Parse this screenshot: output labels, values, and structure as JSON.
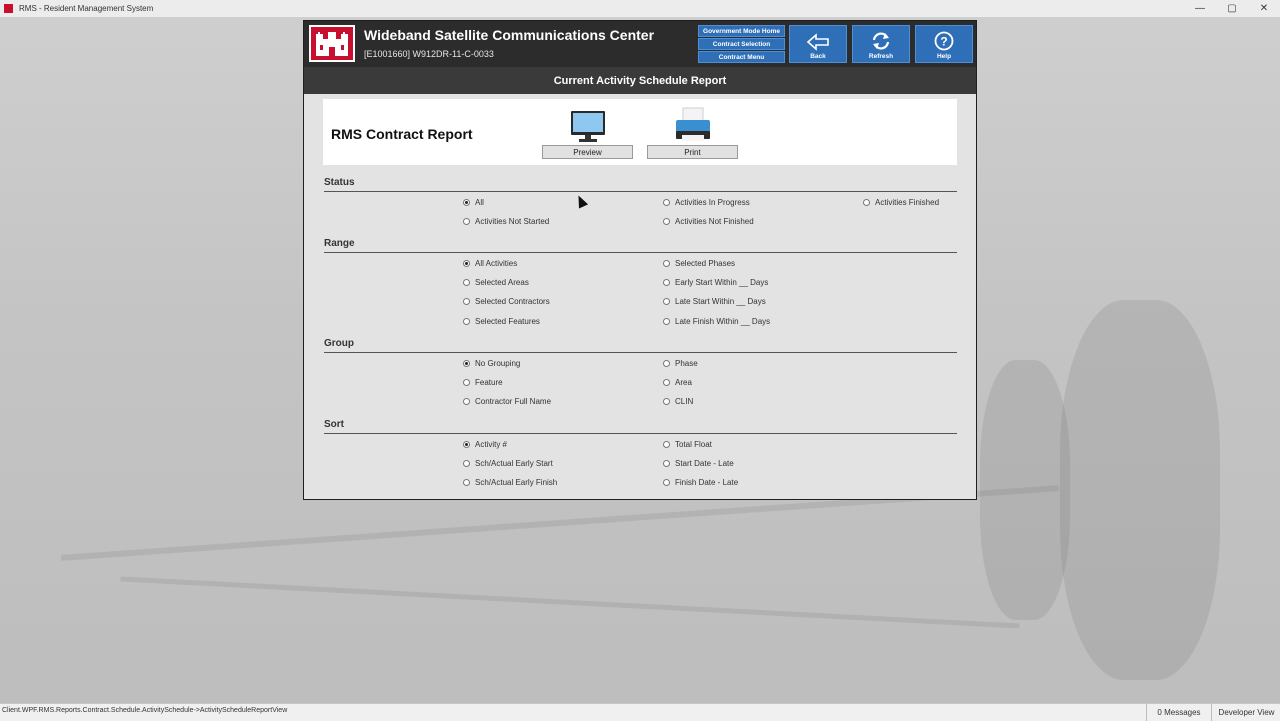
{
  "window": {
    "title": "RMS - Resident Management System"
  },
  "window_controls": {
    "minimize": "—",
    "maximize": "▢",
    "close": "✕"
  },
  "header": {
    "center_name": "Wideband Satellite Communications Center",
    "contract_id": "[E1001660] W912DR-11-C-0033",
    "nav_links": [
      "Government Mode Home",
      "Contract Selection",
      "Contract Menu"
    ],
    "buttons": {
      "back": "Back",
      "refresh": "Refresh",
      "help": "Help"
    }
  },
  "subheader": {
    "title": "Current Activity Schedule Report"
  },
  "report": {
    "title": "RMS Contract Report",
    "preview_label": "Preview",
    "print_label": "Print"
  },
  "sections": {
    "status": {
      "label": "Status",
      "options": [
        "All",
        "Activities In Progress",
        "Activities Finished",
        "Activities Not Started",
        "Activities Not Finished"
      ],
      "selected": "All"
    },
    "range": {
      "label": "Range",
      "options": [
        "All Activities",
        "Selected Phases",
        "Selected Areas",
        "Early Start Within __ Days",
        "Selected Contractors",
        "Late Start Within __ Days",
        "Selected Features",
        "Late Finish Within __ Days"
      ],
      "selected": "All Activities"
    },
    "group": {
      "label": "Group",
      "options": [
        "No Grouping",
        "Phase",
        "Feature",
        "Area",
        "Contractor Full Name",
        "CLIN"
      ],
      "selected": "No Grouping"
    },
    "sort": {
      "label": "Sort",
      "options": [
        "Activity #",
        "Total Float",
        "Sch/Actual Early Start",
        "Start Date - Late",
        "Sch/Actual Early Finish",
        "Finish Date - Late"
      ],
      "selected": "Activity #"
    }
  },
  "statusbar": {
    "path": "Client.WPF.RMS.Reports.Contract.Schedule.ActivitySchedule->ActivityScheduleReportView",
    "messages": "0 Messages",
    "view": "Developer View"
  },
  "colors": {
    "brand": "#c8102e",
    "nav_blue": "#2e6fb8",
    "header_dark": "#2c2c2c"
  }
}
